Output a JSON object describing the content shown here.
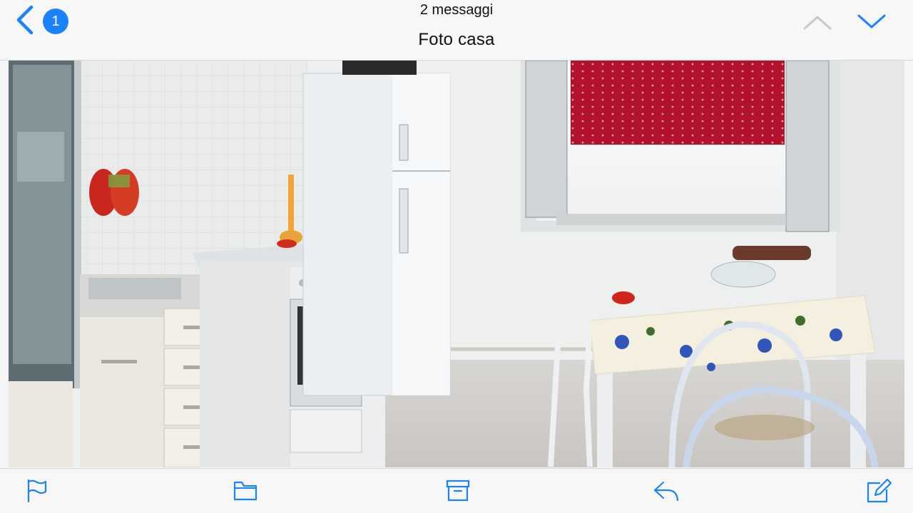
{
  "header": {
    "back_badge_count": "1",
    "message_count": "2 messaggi",
    "subject": "Foto casa"
  },
  "icons": {
    "back": "chevron-left-icon",
    "prev": "chevron-up-icon",
    "next": "chevron-down-icon",
    "flag": "flag-icon",
    "folder": "folder-icon",
    "archive": "archive-icon",
    "reply": "reply-icon",
    "compose": "compose-icon"
  },
  "colors": {
    "accent": "#1a82fb",
    "disabled": "#c7c7cc"
  },
  "photo": {
    "subject": "kitchen with white fridge, stove, cabinets, red roller blind, table with floral tablecloth"
  }
}
